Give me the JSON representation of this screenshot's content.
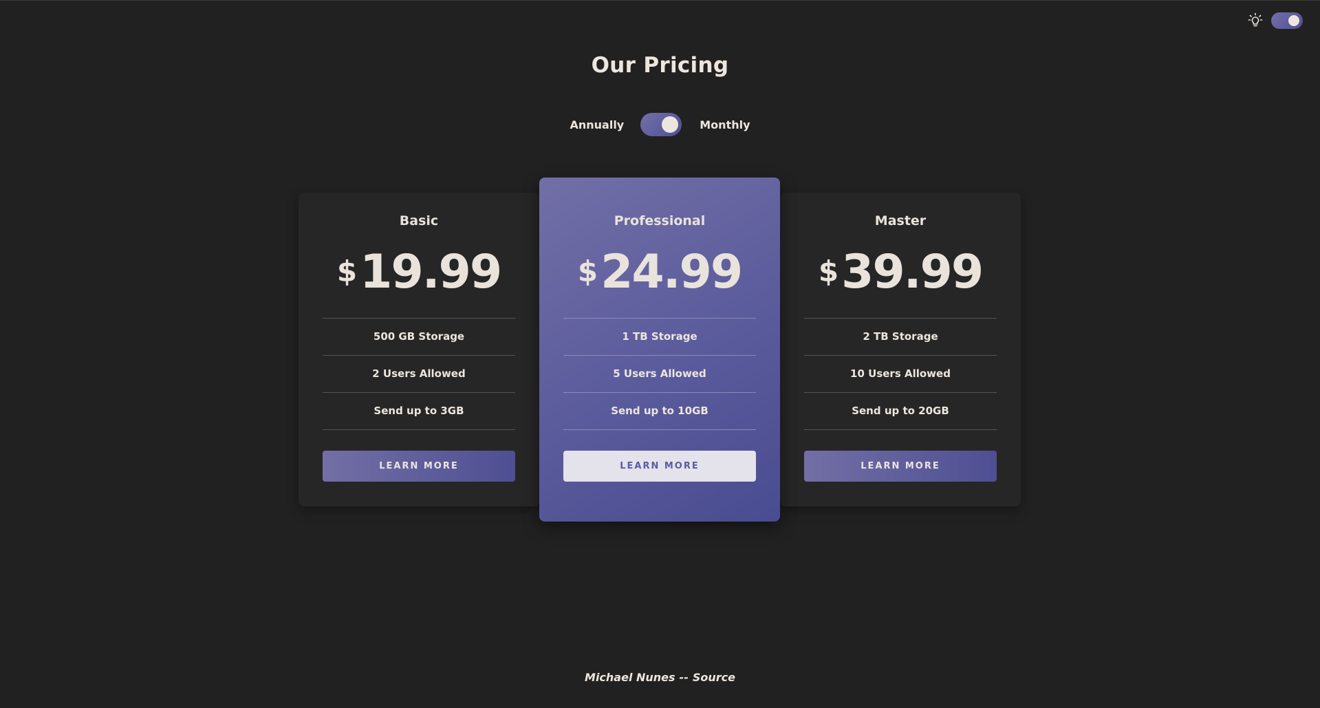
{
  "header": {
    "title": "Our Pricing",
    "theme_toggle_state": "on"
  },
  "billing_toggle": {
    "left_label": "Annually",
    "right_label": "Monthly",
    "state": "on"
  },
  "plans": [
    {
      "name": "Basic",
      "currency": "$",
      "price": "19.99",
      "features": [
        "500 GB Storage",
        "2 Users Allowed",
        "Send up to 3GB"
      ],
      "button_label": "LEARN MORE"
    },
    {
      "name": "Professional",
      "currency": "$",
      "price": "24.99",
      "features": [
        "1 TB Storage",
        "5 Users Allowed",
        "Send up to 10GB"
      ],
      "button_label": "LEARN MORE",
      "featured": true
    },
    {
      "name": "Master",
      "currency": "$",
      "price": "39.99",
      "features": [
        "2 TB Storage",
        "10 Users Allowed",
        "Send up to 20GB"
      ],
      "button_label": "LEARN MORE"
    }
  ],
  "footer": {
    "author": "Michael Nunes",
    "separator": "--",
    "source_label": "Source"
  },
  "colors": {
    "background": "#212121",
    "accent_start": "#726fa6",
    "accent_end": "#4a4c91",
    "text": "#ece6df"
  },
  "icons": {
    "theme": "lightbulb-icon"
  }
}
